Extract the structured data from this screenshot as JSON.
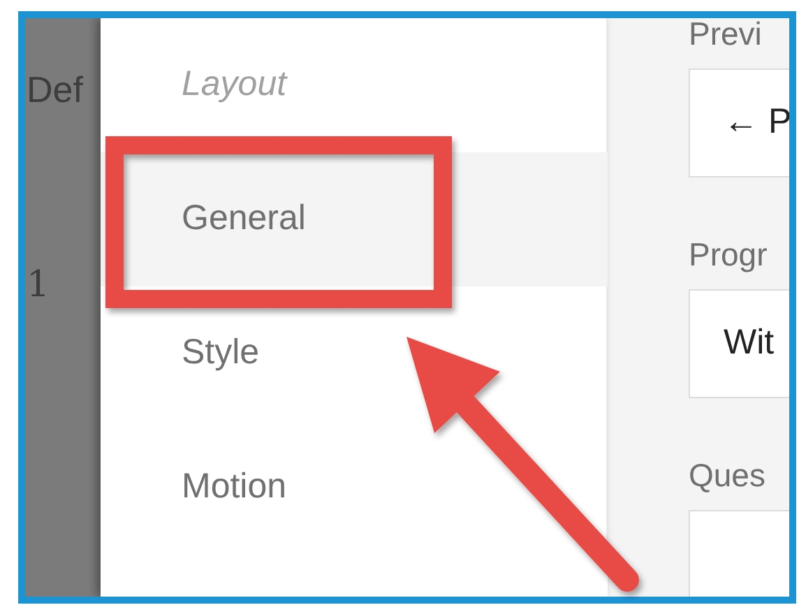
{
  "background_panel": {
    "texts": [
      "Def",
      "1"
    ]
  },
  "menu": {
    "items": [
      {
        "kind": "header",
        "label": "Layout",
        "selected": false
      },
      {
        "kind": "item",
        "label": "General",
        "selected": true
      },
      {
        "kind": "item",
        "label": "Style",
        "selected": false
      },
      {
        "kind": "item",
        "label": "Motion",
        "selected": false
      }
    ]
  },
  "settings": [
    {
      "label": "Previ",
      "value": "← P"
    },
    {
      "label": "Progr",
      "value": "Wit"
    },
    {
      "label": "Ques"
    }
  ]
}
